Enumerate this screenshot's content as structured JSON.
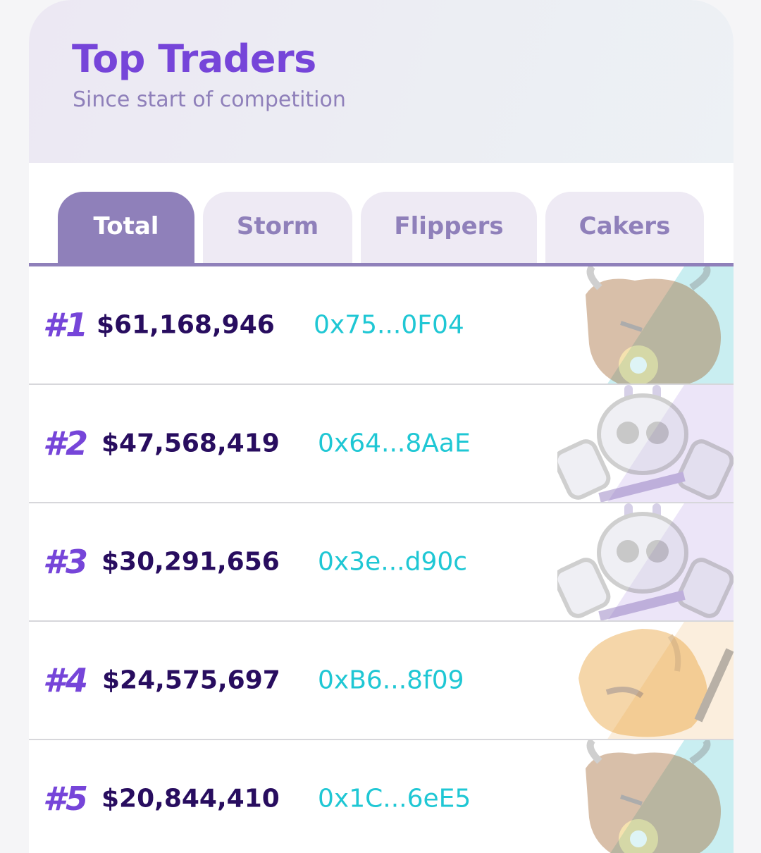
{
  "header": {
    "title": "Top Traders",
    "subtitle": "Since start of competition"
  },
  "tabs": [
    {
      "label": "Total",
      "active": true
    },
    {
      "label": "Storm",
      "active": false
    },
    {
      "label": "Flippers",
      "active": false
    },
    {
      "label": "Cakers",
      "active": false
    }
  ],
  "traders": [
    {
      "rank": "#1",
      "volume": "$61,168,946",
      "address": "0x75...0F04",
      "team": "Storm",
      "team_icon": "bull-mascot-icon"
    },
    {
      "rank": "#2",
      "volume": "$47,568,419",
      "address": "0x64...8AaE",
      "team": "Flippers",
      "team_icon": "bunny-skull-spatulas-icon"
    },
    {
      "rank": "#3",
      "volume": "$30,291,656",
      "address": "0x3e...d90c",
      "team": "Flippers",
      "team_icon": "bunny-skull-spatulas-icon"
    },
    {
      "rank": "#4",
      "volume": "$24,575,697",
      "address": "0xB6...8f09",
      "team": "Cakers",
      "team_icon": "flame-mascot-icon"
    },
    {
      "rank": "#5",
      "volume": "$20,844,410",
      "address": "0x1C...6eE5",
      "team": "Storm",
      "team_icon": "bull-mascot-icon"
    }
  ],
  "colors": {
    "accent": "#7645d9",
    "tab_active": "#8f80ba",
    "address": "#1fc7d4",
    "volume": "#280d5f",
    "storm": "#c9eef1",
    "flippers": "#ece5f8",
    "cakers": "#fbeedd"
  }
}
